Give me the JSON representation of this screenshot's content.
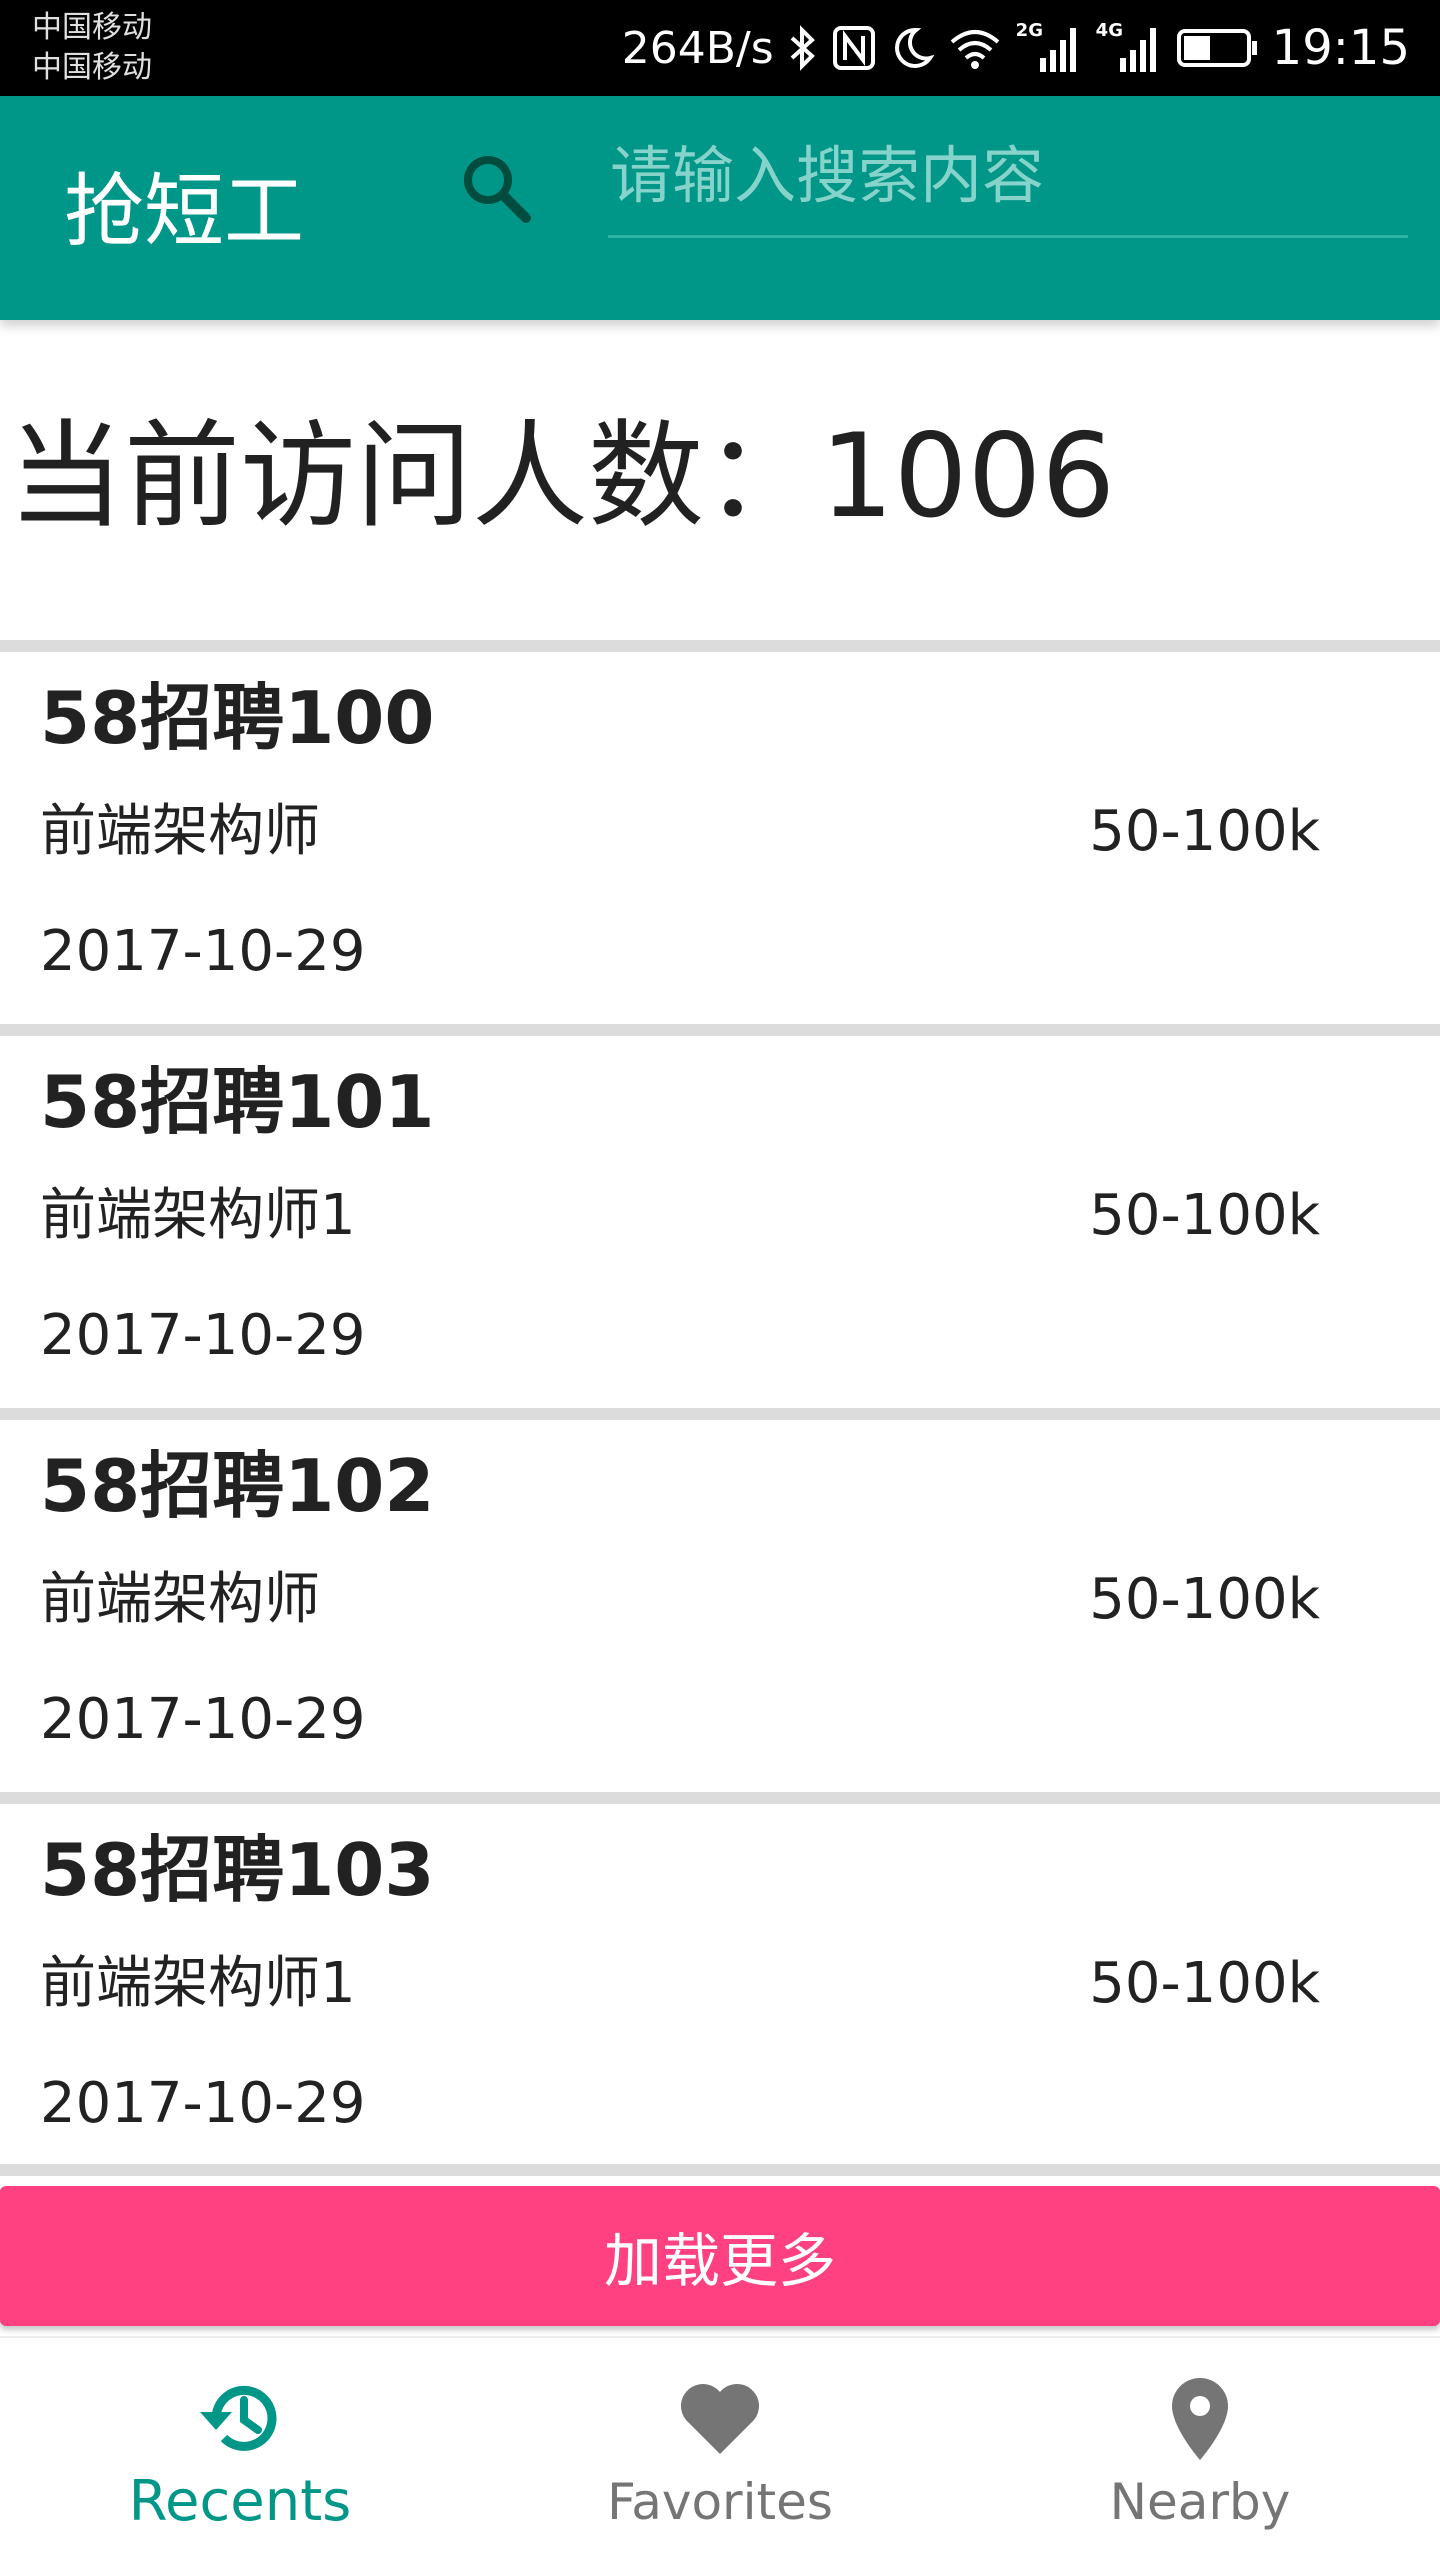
{
  "status_bar": {
    "carrier_1": "中国移动",
    "carrier_2": "中国移动",
    "net_speed": "264B/s",
    "time": "19:15",
    "signal_1_label": "2G",
    "signal_2_label": "4G"
  },
  "app_bar": {
    "title": "抢短工",
    "search_placeholder": "请输入搜索内容",
    "search_value": ""
  },
  "visitor": {
    "label": "当前访问人数：",
    "count": "1006"
  },
  "jobs": [
    {
      "title": "58招聘100",
      "position": "前端架构师",
      "salary": "50-100k",
      "date": "2017-10-29"
    },
    {
      "title": "58招聘101",
      "position": "前端架构师1",
      "salary": "50-100k",
      "date": "2017-10-29"
    },
    {
      "title": "58招聘102",
      "position": "前端架构师",
      "salary": "50-100k",
      "date": "2017-10-29"
    },
    {
      "title": "58招聘103",
      "position": "前端架构师1",
      "salary": "50-100k",
      "date": "2017-10-29"
    }
  ],
  "load_more_label": "加载更多",
  "bottom_nav": {
    "items": [
      {
        "label": "Recents",
        "icon": "history-icon",
        "active": true
      },
      {
        "label": "Favorites",
        "icon": "heart-icon",
        "active": false
      },
      {
        "label": "Nearby",
        "icon": "location-pin-icon",
        "active": false
      }
    ]
  },
  "colors": {
    "primary": "#009688",
    "accent": "#ff4081",
    "status_bar": "#000000",
    "inactive_nav": "#757575"
  }
}
